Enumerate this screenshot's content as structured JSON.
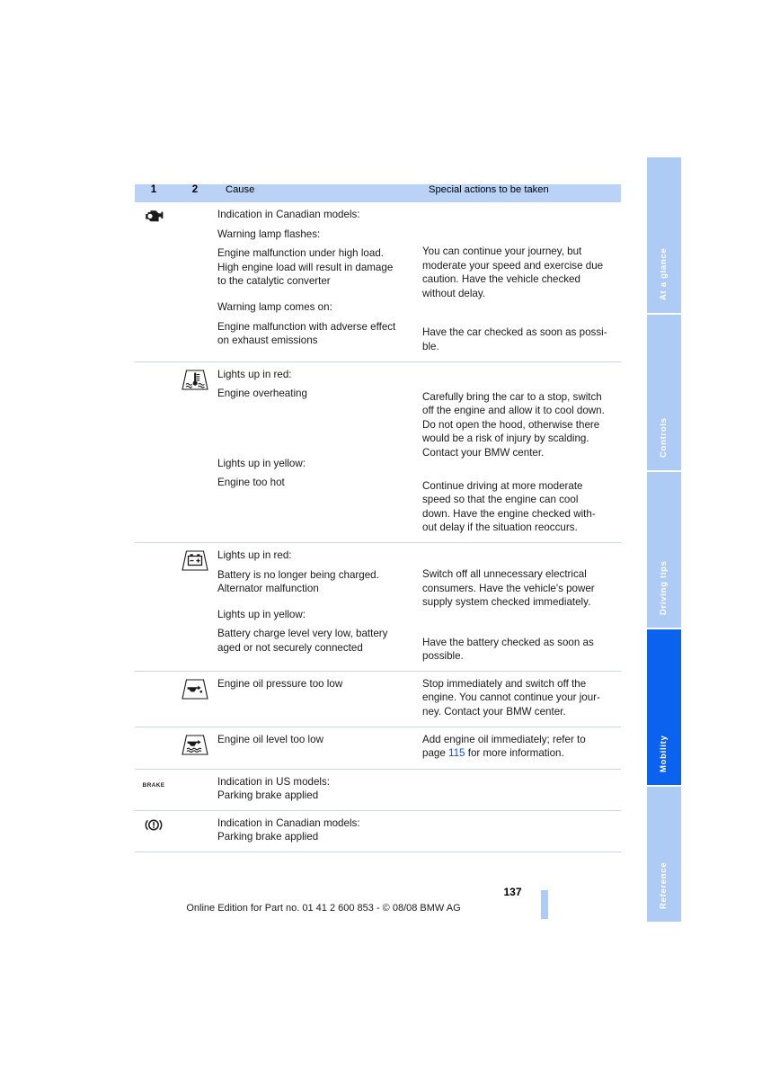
{
  "document": {
    "page_number": "137",
    "footer_text": "Online Edition for Part no. 01 41 2 600 853 - © 08/08 BMW AG"
  },
  "sidebar": {
    "tabs": [
      {
        "label": "At a glance",
        "active": false
      },
      {
        "label": "Controls",
        "active": false
      },
      {
        "label": "Driving tips",
        "active": false
      },
      {
        "label": "Mobility",
        "active": true
      },
      {
        "label": "Reference",
        "active": false
      }
    ],
    "active_color": "#0a62ef",
    "inactive_color": "#aecbf5"
  },
  "table": {
    "header": {
      "col1": "1",
      "col2": "2",
      "cause": "Cause",
      "actions": "Special actions to be taken"
    },
    "header_bg": "#b9d2f5",
    "rows": [
      {
        "icon1": "check-engine-icon",
        "icon2": null,
        "cause_lines": [
          "Indication in Canadian models:",
          "Warning lamp flashes:",
          "Engine malfunction under high load.",
          "High engine load will result in damage",
          "to the catalytic converter",
          "Warning lamp comes on:",
          "Engine malfunction with adverse effect",
          "on exhaust emissions"
        ],
        "action_lines_a": [
          "You can continue your journey, but",
          "moderate your speed and exercise due",
          "caution. Have the vehicle checked",
          "without delay."
        ],
        "action_lines_b": [
          "Have the car checked as soon as possi-",
          "ble."
        ]
      },
      {
        "icon1": null,
        "icon2": "coolant-temperature-icon",
        "cause_lines_a": [
          "Lights up in red:",
          "Engine overheating"
        ],
        "cause_lines_b": [
          "Lights up in yellow:",
          "Engine too hot"
        ],
        "action_lines_a": [
          "Carefully bring the car to a stop, switch",
          "off the engine and allow it to cool down.",
          "Do not open the hood, otherwise there",
          "would be a risk of injury by scalding.",
          "Contact your BMW center."
        ],
        "action_lines_b": [
          "Continue driving at more moderate",
          "speed so that the engine can cool",
          "down. Have the engine checked with-",
          "out delay if the situation reoccurs."
        ]
      },
      {
        "icon1": null,
        "icon2": "battery-charge-icon",
        "cause_lines_a": [
          "Lights up in red:",
          "Battery is no longer being charged.",
          "Alternator malfunction"
        ],
        "cause_lines_b": [
          "Lights up in yellow:",
          "Battery charge level very low, battery",
          "aged or not securely connected"
        ],
        "action_lines_a": [
          "Switch off all unnecessary electrical",
          "consumers. Have the vehicle's power",
          "supply system checked immediately."
        ],
        "action_lines_b": [
          "Have the battery checked as soon as",
          "possible."
        ]
      },
      {
        "icon1": null,
        "icon2": "engine-oil-pressure-icon",
        "cause_lines": [
          "Engine oil pressure too low"
        ],
        "action_lines": [
          "Stop immediately and switch off the",
          "engine. You cannot continue your jour-",
          "ney. Contact your BMW center."
        ]
      },
      {
        "icon1": null,
        "icon2": "engine-oil-level-icon",
        "cause_lines": [
          "Engine oil level too low"
        ],
        "action_prefix": "Add engine oil immediately; refer to",
        "action_page_word": "page ",
        "action_page_link": "115",
        "action_suffix": " for more information."
      },
      {
        "icon1": "brake-text-icon",
        "icon2": null,
        "icon1_text": "BRAKE",
        "cause_lines": [
          "Indication in US models:",
          "Parking brake applied"
        ],
        "action_lines": []
      },
      {
        "icon1": "brake-warning-icon",
        "icon2": null,
        "cause_lines": [
          "Indication in Canadian models:",
          "Parking brake applied"
        ],
        "action_lines": []
      }
    ]
  }
}
